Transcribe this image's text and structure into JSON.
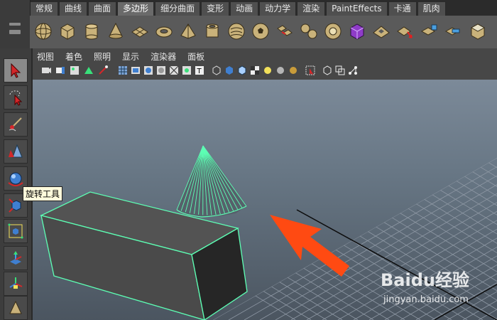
{
  "shelf": {
    "tabs": [
      "常规",
      "曲线",
      "曲面",
      "多边形",
      "细分曲面",
      "变形",
      "动画",
      "动力学",
      "渲染",
      "PaintEffects",
      "卡通",
      "肌肉"
    ],
    "active_tab": "多边形",
    "icons": [
      "sphere-icon",
      "cube-icon",
      "cylinder-icon",
      "cone-icon",
      "plane-icon",
      "torus-icon",
      "pyramid-icon",
      "pipe-icon",
      "helix-icon",
      "soccer-ball-icon",
      "combine-icon",
      "separate-icon",
      "extract-icon",
      "smooth-icon",
      "boolean-icon",
      "extrude-icon",
      "bridge-icon",
      "append-icon",
      "split-icon",
      "bevel-icon",
      "wedge-icon"
    ]
  },
  "panel": {
    "menu": [
      "视图",
      "着色",
      "照明",
      "显示",
      "渲染器",
      "面板"
    ]
  },
  "toolbox": {
    "tools": [
      "select-tool",
      "lasso-tool",
      "paint-select-tool",
      "move-tool",
      "rotate-tool",
      "scale-tool",
      "universal-manipulator",
      "soft-mod-tool",
      "show-manipulator",
      "last-used-tool"
    ],
    "tooltip": "旋转工具"
  },
  "watermark": {
    "logo": "Baidu经验",
    "url": "jingyan.baidu.com"
  },
  "colors": {
    "wireframe": "#5dffb4",
    "arrow": "#ff4a12",
    "viewport_top": "#7c8a99",
    "viewport_bottom": "#4b5560"
  }
}
